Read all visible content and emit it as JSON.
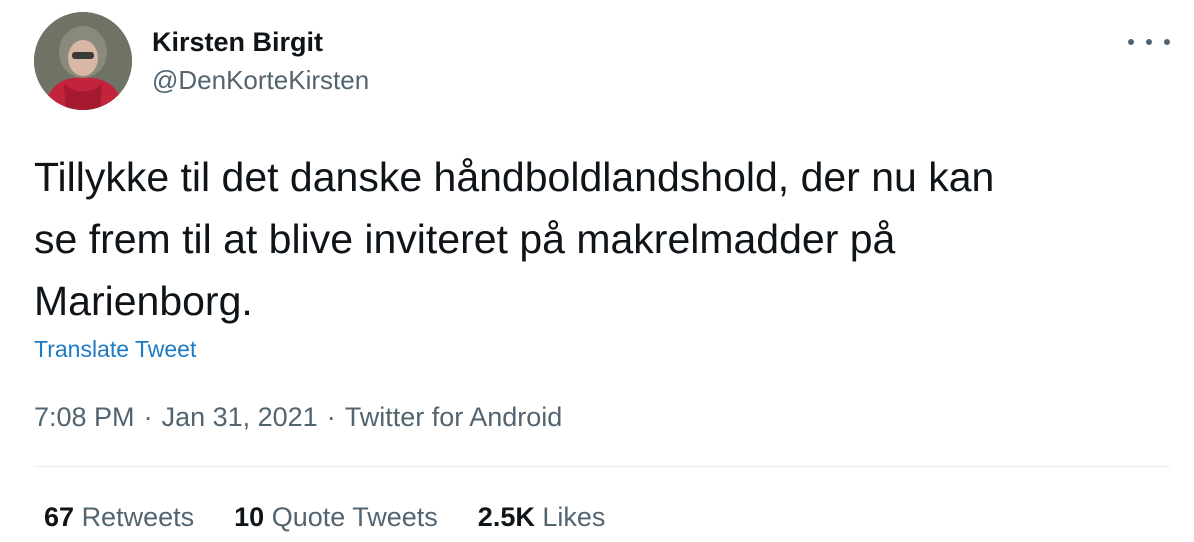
{
  "user": {
    "display_name": "Kirsten Birgit",
    "handle": "@DenKorteKirsten",
    "avatar_icon": "profile-photo"
  },
  "menu_icon": "more-horizontal-icon",
  "tweet": {
    "lines": [
      "Tillykke til det danske håndboldlandshold, der nu kan",
      "se frem til at blive inviteret på makrelmadder på",
      "Marienborg."
    ]
  },
  "translate_label": "Translate Tweet",
  "meta": {
    "time": "7:08 PM",
    "separator": "·",
    "date": "Jan 31, 2021",
    "source": "Twitter for Android"
  },
  "stats": [
    {
      "count": "67",
      "label": "Retweets"
    },
    {
      "count": "10",
      "label": "Quote Tweets"
    },
    {
      "count": "2.5K",
      "label": "Likes"
    }
  ],
  "colors": {
    "text": "#0f1419",
    "secondary": "#536471",
    "link": "#1d7bc6",
    "divider": "#e6ecf0"
  }
}
